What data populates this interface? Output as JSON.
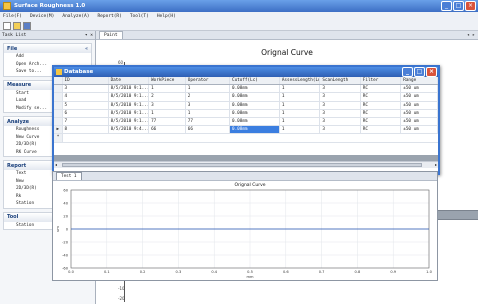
{
  "window": {
    "title": "Surface Roughness 1.0"
  },
  "menu": [
    "File(F)",
    "Device(M)",
    "Analyze(A)",
    "Report(R)",
    "Tool(T)",
    "Help(H)"
  ],
  "tasklist": {
    "title": "Task List",
    "pin": "▾ ✕",
    "groups": [
      {
        "name": "File",
        "items": [
          "Add",
          "Open Arch...",
          "Save to..."
        ]
      },
      {
        "name": "Measure",
        "items": [
          "Start",
          "Load",
          "Modify se..."
        ]
      },
      {
        "name": "Analyze",
        "items": [
          "Roughness",
          "New Curve",
          "2D/3D(R)",
          "RK Curve"
        ]
      },
      {
        "name": "Report",
        "items": [
          "Text",
          "New",
          "2D/3D(R)",
          "Rk",
          "Station"
        ]
      },
      {
        "name": "Tool",
        "items": [
          "Station"
        ]
      }
    ]
  },
  "plot": {
    "tab": "Paint",
    "title": "Orignal Curve",
    "bg_ticks": [
      "60",
      "-10",
      "-20"
    ]
  },
  "database": {
    "title": "Database",
    "columns": [
      "ID",
      "Date",
      "WorkPiece",
      "Operator",
      "Cutoff(Lc)",
      "AssessLength(Ln)",
      "ScanLength",
      "Filter",
      "Range"
    ],
    "rows": [
      [
        "3",
        "8/5/2010 9:1...",
        "1",
        "1",
        "0.08mm",
        "1",
        "3",
        "RC",
        "±50 um"
      ],
      [
        "4",
        "8/5/2010 9:1...",
        "2",
        "2",
        "0.08mm",
        "1",
        "3",
        "RC",
        "±50 um"
      ],
      [
        "5",
        "8/5/2010 9:1...",
        "3",
        "3",
        "0.08mm",
        "1",
        "3",
        "RC",
        "±50 um"
      ],
      [
        "6",
        "8/5/2010 9:1...",
        "1",
        "1",
        "0.08mm",
        "1",
        "3",
        "RC",
        "±50 um"
      ],
      [
        "7",
        "8/5/2010 9:1...",
        "77",
        "77",
        "0.08mm",
        "1",
        "3",
        "RC",
        "±50 um"
      ],
      [
        "8",
        "8/5/2010 9:4...",
        "66",
        "66",
        "0.08mm",
        "1",
        "3",
        "RC",
        "±50 um"
      ]
    ],
    "current_row_marker": "▶",
    "new_row_marker": "*"
  },
  "chart_panel": {
    "tab": "Test 1"
  },
  "chart_data": {
    "type": "line",
    "title": "Orignal Curve",
    "xlabel": "mm",
    "ylabel": "um",
    "xlim": [
      0,
      1
    ],
    "ylim": [
      -60,
      60
    ],
    "xticks": [
      "0.0",
      "0.1",
      "0.2",
      "0.3",
      "0.4",
      "0.5",
      "0.6",
      "0.7",
      "0.8",
      "0.9",
      "1.0"
    ],
    "yticks": [
      "60",
      "40",
      "20",
      "0",
      "-20",
      "-40",
      "-60"
    ],
    "series": [
      {
        "x": [
          0.0,
          1.0
        ],
        "y": [
          0,
          0
        ]
      }
    ],
    "grid": true
  },
  "colors": {
    "accent": "#3b7ee0",
    "title_bar": "#3d6fc4"
  }
}
